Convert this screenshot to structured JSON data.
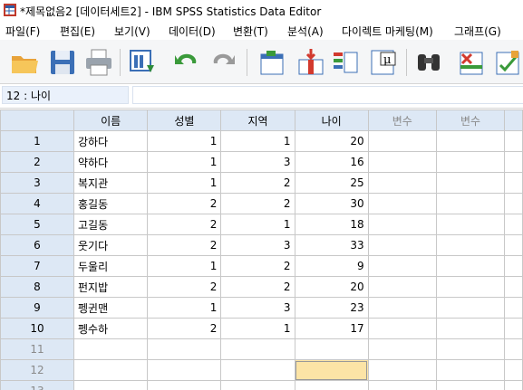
{
  "window": {
    "title": "*제목없음2 [데이터세트2] - IBM SPSS Statistics Data Editor"
  },
  "menu": [
    {
      "label": "파일(F)"
    },
    {
      "label": "편집(E)"
    },
    {
      "label": "보기(V)"
    },
    {
      "label": "데이터(D)"
    },
    {
      "label": "변환(T)"
    },
    {
      "label": "분석(A)"
    },
    {
      "label": "다이렉트 마케팅(M)"
    },
    {
      "label": "그래프(G)"
    }
  ],
  "toolbar": {
    "icons": [
      "open-folder-icon",
      "save-icon",
      "print-icon",
      "dialog-recall-icon",
      "undo-icon",
      "redo-icon",
      "goto-case-icon",
      "goto-variable-icon",
      "variables-icon",
      "descriptives-icon",
      "find-icon",
      "insert-cases-icon",
      "insert-variable-icon"
    ]
  },
  "cell_editor": {
    "ref": "12 : 나이",
    "value": ""
  },
  "grid": {
    "columns": [
      "이름",
      "성별",
      "지역",
      "나이",
      "변수",
      "변수"
    ],
    "column_types": [
      "str",
      "num",
      "num",
      "num",
      "empty",
      "empty"
    ],
    "rows": [
      {
        "num": "1",
        "cells": [
          "강하다",
          "1",
          "1",
          "20",
          "",
          ""
        ]
      },
      {
        "num": "2",
        "cells": [
          "약하다",
          "1",
          "3",
          "16",
          "",
          ""
        ]
      },
      {
        "num": "3",
        "cells": [
          "복지관",
          "1",
          "2",
          "25",
          "",
          ""
        ]
      },
      {
        "num": "4",
        "cells": [
          "홍길동",
          "2",
          "2",
          "30",
          "",
          ""
        ]
      },
      {
        "num": "5",
        "cells": [
          "고길동",
          "2",
          "1",
          "18",
          "",
          ""
        ]
      },
      {
        "num": "6",
        "cells": [
          "웃기다",
          "2",
          "3",
          "33",
          "",
          ""
        ]
      },
      {
        "num": "7",
        "cells": [
          "두울리",
          "1",
          "2",
          "9",
          "",
          ""
        ]
      },
      {
        "num": "8",
        "cells": [
          "펀지밥",
          "2",
          "2",
          "20",
          "",
          ""
        ]
      },
      {
        "num": "9",
        "cells": [
          "펭귄맨",
          "1",
          "3",
          "23",
          "",
          ""
        ]
      },
      {
        "num": "10",
        "cells": [
          "펭수하",
          "2",
          "1",
          "17",
          "",
          ""
        ]
      },
      {
        "num": "11",
        "cells": [
          "",
          "",
          "",
          "",
          "",
          ""
        ],
        "empty": true
      },
      {
        "num": "12",
        "cells": [
          "",
          "",
          "",
          "",
          "",
          ""
        ],
        "empty": true,
        "selected_col": 3
      },
      {
        "num": "13",
        "cells": [
          "",
          "",
          "",
          "",
          "",
          ""
        ],
        "empty": true
      }
    ]
  },
  "colors": {
    "header_bg": "#dde8f5",
    "selected_cell": "#fce4a6",
    "empty_header_text": "#8a8a8a"
  }
}
